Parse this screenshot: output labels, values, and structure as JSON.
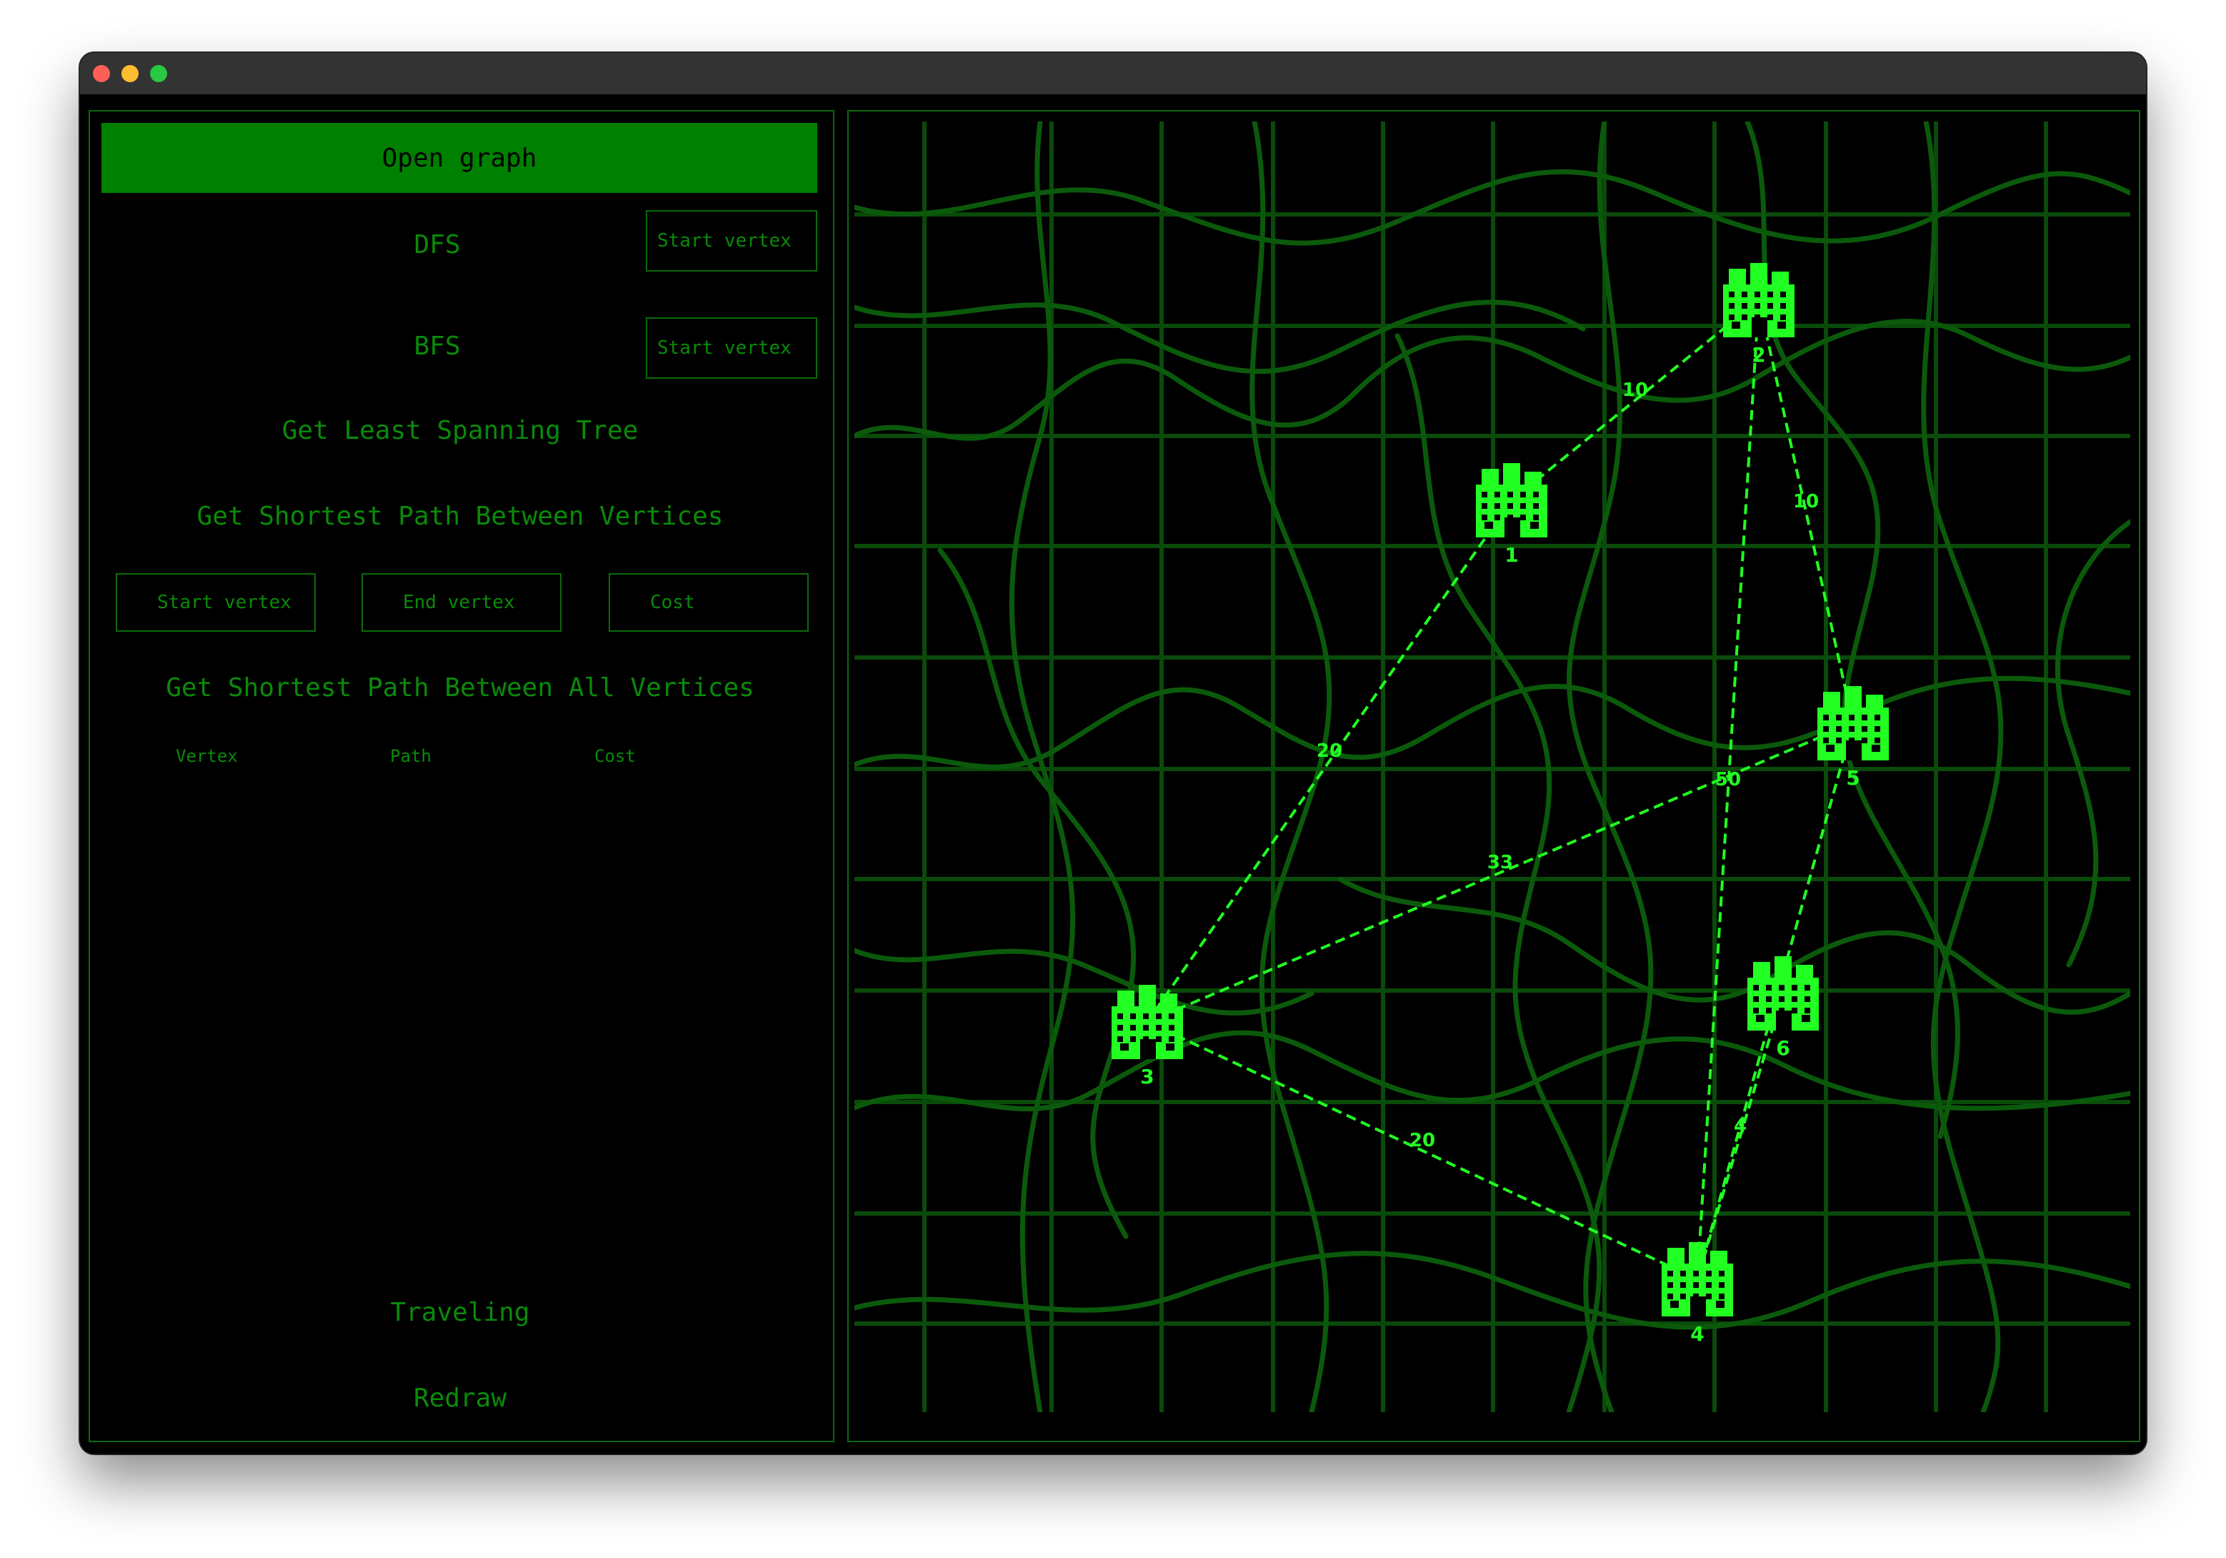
{
  "window": {
    "traffic_lights": [
      "close",
      "minimize",
      "zoom"
    ]
  },
  "sidebar": {
    "open_graph": "Open graph",
    "dfs": "DFS",
    "dfs_start_placeholder": "Start vertex",
    "bfs": "BFS",
    "bfs_start_placeholder": "Start vertex",
    "least_spanning_tree": "Get Least Spanning Tree",
    "shortest_path_between_vertices": "Get Shortest Path Between Vertices",
    "sp_start_placeholder": "Start vertex",
    "sp_end_placeholder": "End vertex",
    "sp_cost_placeholder": "Cost",
    "shortest_path_all": "Get Shortest Path Between All Vertices",
    "table_headers": {
      "vertex": "Vertex",
      "path": "Path",
      "cost": "Cost"
    },
    "traveling": "Traveling",
    "redraw": "Redraw"
  },
  "graph": {
    "vertices": [
      "1",
      "2",
      "3",
      "4",
      "5",
      "6"
    ],
    "edges": [
      {
        "from": "1",
        "to": "2",
        "weight": "10"
      },
      {
        "from": "2",
        "to": "5",
        "weight": "10"
      },
      {
        "from": "1",
        "to": "3",
        "weight": "20"
      },
      {
        "from": "2",
        "to": "4",
        "weight": "50"
      },
      {
        "from": "3",
        "to": "5",
        "weight": "33"
      },
      {
        "from": "3",
        "to": "4",
        "weight": "20"
      },
      {
        "from": "5",
        "to": "4",
        "weight": "1"
      },
      {
        "from": "6",
        "to": "4",
        "weight": "4"
      }
    ],
    "icon": "city-building-icon"
  },
  "colors": {
    "background": "#000000",
    "accent": "#008000",
    "text": "#0a8a0a",
    "map_lines": "#0b5a0b",
    "graph": "#22ff22"
  }
}
